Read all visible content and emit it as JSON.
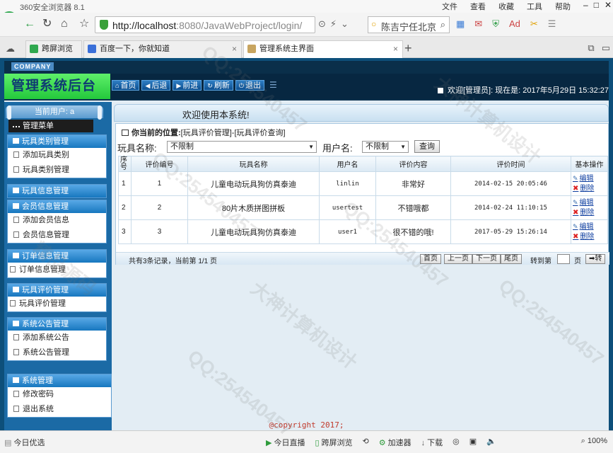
{
  "browser": {
    "app_title": "360安全浏览器 8.1",
    "menus": [
      "文件",
      "查看",
      "收藏",
      "工具",
      "帮助"
    ],
    "url_host": "http://localhost",
    "url_rest": ":8080/JavaWebProject/login/",
    "search_text": "陈吉宁任北京",
    "tabs": [
      {
        "label": "跨屏浏览"
      },
      {
        "label": "百度一下，你就知道"
      },
      {
        "label": "管理系统主界面"
      }
    ]
  },
  "header": {
    "company": "COMPANY",
    "system_title": "管理系统后台",
    "toolbar": [
      {
        "label": "首页"
      },
      {
        "label": "后退"
      },
      {
        "label": "前进"
      },
      {
        "label": "刷新"
      },
      {
        "label": "退出"
      }
    ],
    "welcome": "欢迎[管理员]:   现在是: 2017年5月29日 15:32:27"
  },
  "sidebar": {
    "current_user": "当前用户: a",
    "menu_title": "管理菜单",
    "groups": [
      {
        "title": "玩具类别管理",
        "items": [
          "添加玩具类别",
          "玩具类别管理"
        ]
      },
      {
        "title": "玩具信息管理",
        "items": []
      },
      {
        "title": "会员信息管理",
        "items": [
          "添加会员信息",
          "会员信息管理"
        ]
      },
      {
        "title": "订单信息管理",
        "items": [
          "订单信息管理"
        ]
      },
      {
        "title": "玩具评价管理",
        "items": [
          "玩具评价管理"
        ]
      },
      {
        "title": "系统公告管理",
        "items": [
          "添加系统公告",
          "系统公告管理"
        ]
      },
      {
        "title": "系统管理",
        "items": [
          "修改密码",
          "退出系统"
        ]
      }
    ]
  },
  "main": {
    "welcome": "欢迎使用本系统!",
    "crumb_label": "你当前的位置:",
    "crumb_path": "[玩具评价管理]-[玩具评价查询]",
    "filter": {
      "toy_label": "玩具名称:",
      "toy_value": "不限制",
      "user_label": "用户名:",
      "user_value": "不限制",
      "query_button": "查询"
    },
    "columns": [
      "序号",
      "评价编号",
      "玩具名称",
      "用户名",
      "评价内容",
      "评价时间",
      "基本操作"
    ],
    "rows": [
      {
        "no": "1",
        "id": "1",
        "toy": "儿童电动玩具狗仿真泰迪",
        "user": "linlin",
        "content": "非常好",
        "time": "2014-02-15 20:05:46"
      },
      {
        "no": "2",
        "id": "2",
        "toy": "80片木质拼图拼板",
        "user": "usertest",
        "content": "不错哦都",
        "time": "2014-02-24 11:10:15"
      },
      {
        "no": "3",
        "id": "3",
        "toy": "儿童电动玩具狗仿真泰迪",
        "user": "user1",
        "content": "很不错的哦!",
        "time": "2017-05-29 15:26:14"
      }
    ],
    "edit_label": "编辑",
    "delete_label": "删除",
    "pager": {
      "summary": "共有3条记录，当前第 1/1 页",
      "first": "首页",
      "prev": "上一页",
      "next": "下一页",
      "last": "尾页",
      "goto_label": "转到第",
      "page_unit": "页",
      "go": "转"
    }
  },
  "footer": {
    "copyright": "@copyright 2017;"
  },
  "statusbar": {
    "left": "今日优选",
    "items": [
      "今日直播",
      "跨屏浏览",
      "",
      "加速器",
      "下载",
      "",
      "",
      ""
    ],
    "zoom": "100%"
  },
  "watermarks": [
    "QQ:254540457",
    "大神计算机设计",
    "精品源码"
  ]
}
